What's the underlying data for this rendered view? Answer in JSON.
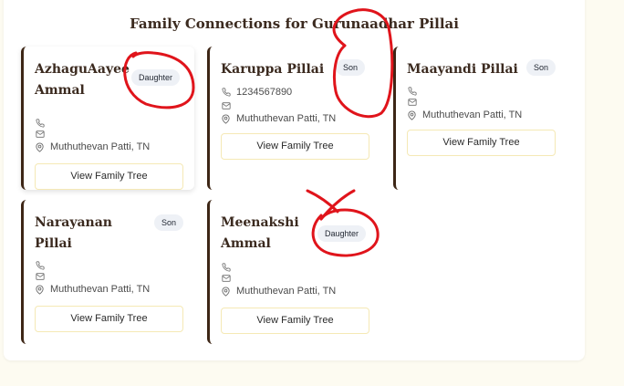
{
  "page": {
    "title": "Family Connections for Gurunaadhar Pillai"
  },
  "cards": [
    {
      "name_line1": "AzhaguAayee",
      "name_line2": "Ammal",
      "relation": "Daughter",
      "phone": "",
      "address": "Muthuthevan Patti, TN",
      "button": "View Family Tree"
    },
    {
      "name_line1": "Karuppa Pillai",
      "name_line2": "",
      "relation": "Son",
      "phone": "1234567890",
      "address": "Muthuthevan Patti, TN",
      "button": "View Family Tree"
    },
    {
      "name_line1": "Maayandi Pillai",
      "name_line2": "",
      "relation": "Son",
      "phone": "",
      "address": "Muthuthevan Patti, TN",
      "button": "View Family Tree"
    },
    {
      "name_line1": "Narayanan Pillai",
      "name_line2": "",
      "relation": "Son",
      "phone": "",
      "address": "Muthuthevan Patti, TN",
      "button": "View Family Tree"
    },
    {
      "name_line1": "Meenakshi",
      "name_line2": "Ammal",
      "relation": "Daughter",
      "phone": "",
      "address": "Muthuthevan Patti, TN",
      "button": "View Family Tree"
    }
  ],
  "colors": {
    "card_border": "#3d2616",
    "annotation": "#e0141b",
    "badge_bg": "#eef1f6",
    "button_border": "#f5e9b5"
  },
  "icons": {
    "phone": "phone-icon",
    "email": "mail-icon",
    "location": "map-pin-icon"
  }
}
